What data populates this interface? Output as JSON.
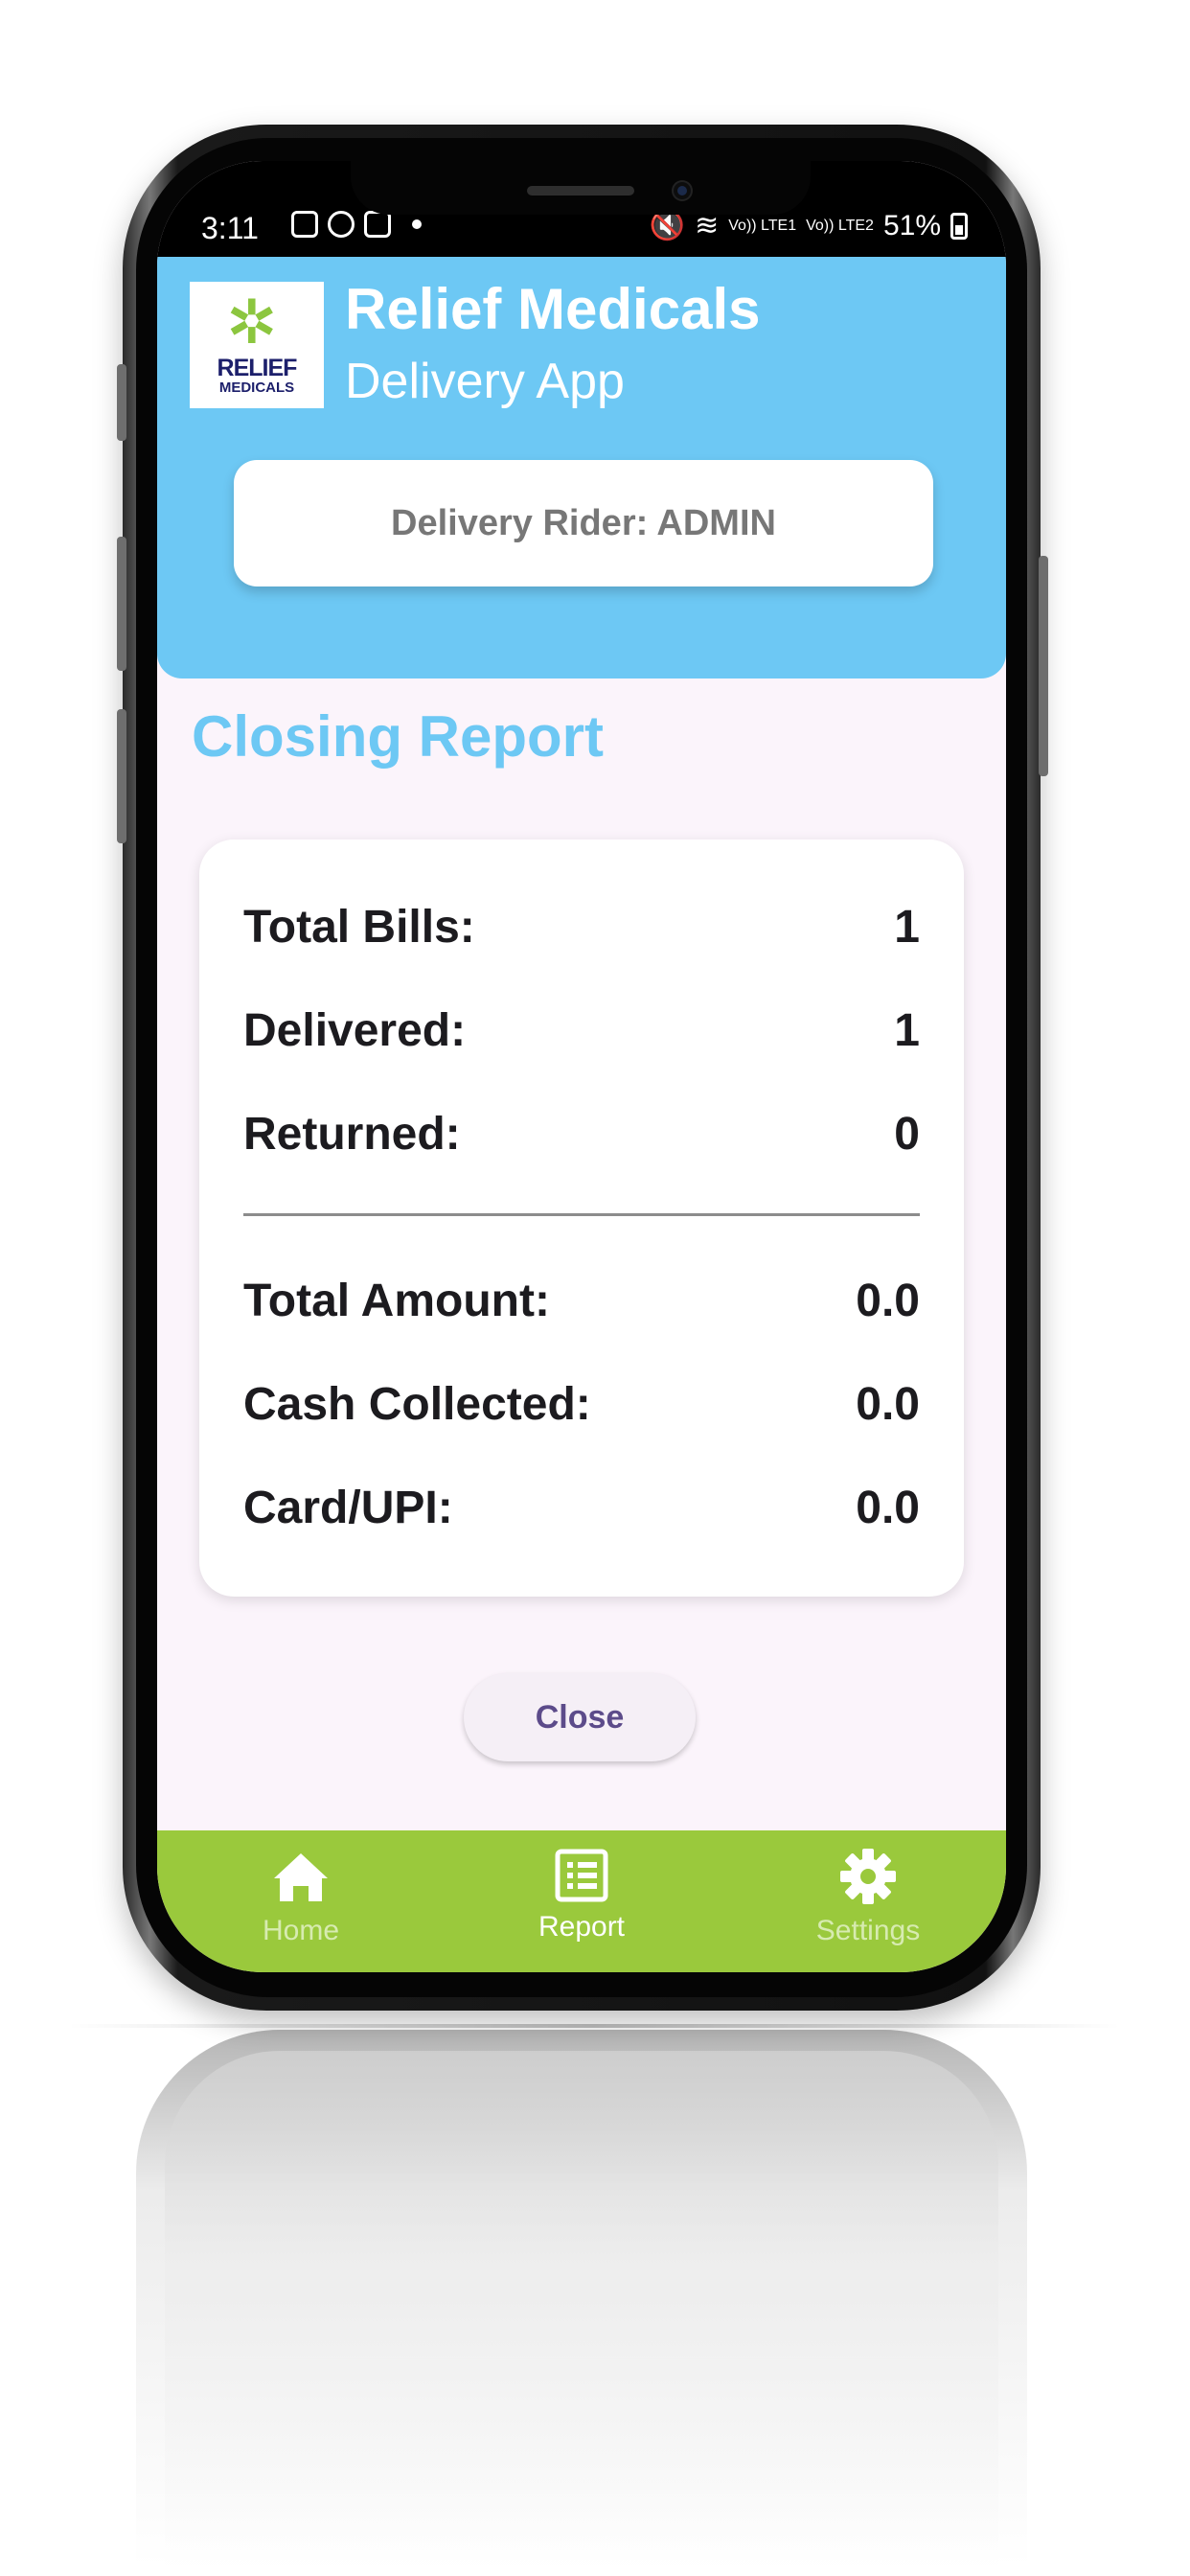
{
  "status_bar": {
    "time": "3:11",
    "battery": "51%",
    "network_labels": [
      "Vo)) LTE1",
      "Vo)) LTE2"
    ]
  },
  "header": {
    "logo_line1": "RELIEF",
    "logo_line2": "MEDICALS",
    "app_title": "Relief Medicals",
    "app_subtitle": "Delivery App",
    "rider_label": "Delivery Rider: ADMIN"
  },
  "page": {
    "title": "Closing Report"
  },
  "report": {
    "rows": [
      {
        "label": "Total Bills:",
        "value": "1"
      },
      {
        "label": "Delivered:",
        "value": "1"
      },
      {
        "label": "Returned:",
        "value": "0"
      },
      {
        "label": "Total Amount:",
        "value": "0.0"
      },
      {
        "label": "Cash Collected:",
        "value": "0.0"
      },
      {
        "label": "Card/UPI:",
        "value": "0.0"
      }
    ]
  },
  "actions": {
    "close_label": "Close"
  },
  "bottom_nav": {
    "items": [
      {
        "label": "Home",
        "icon": "home-icon",
        "active": false
      },
      {
        "label": "Report",
        "icon": "report-icon",
        "active": true
      },
      {
        "label": "Settings",
        "icon": "gear-icon",
        "active": false
      }
    ]
  },
  "colors": {
    "header_blue": "#6dc8f4",
    "nav_green": "#9ac93c",
    "screen_bg": "#fbf4fb",
    "button_text": "#5c4b8a"
  }
}
